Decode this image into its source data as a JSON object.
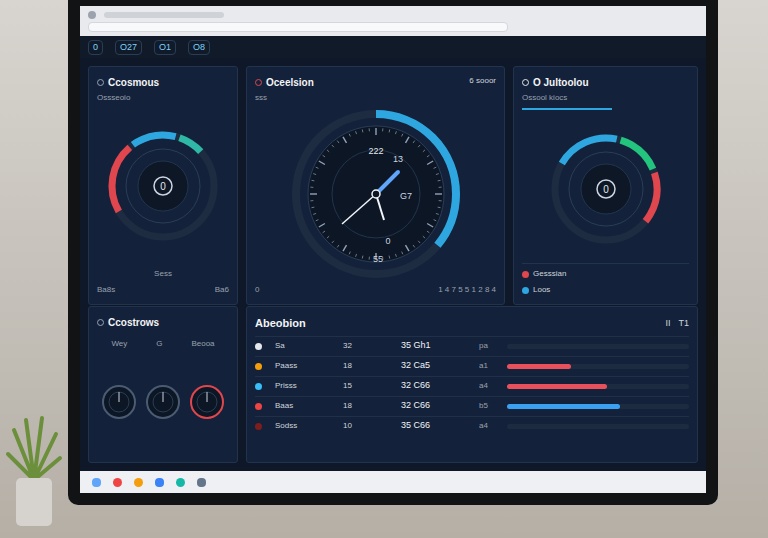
{
  "app_header": {
    "items": [
      "0",
      "O27",
      "O1",
      "O8"
    ]
  },
  "left_gauge": {
    "title": "Ccosmous",
    "subtitle": "Ossseoio",
    "center": "0",
    "label": "Sess",
    "footer_left": "Ba8s",
    "footer_right": "Ba6",
    "segments": [
      {
        "color": "#e0464e",
        "level": 0.22
      },
      {
        "color": "#2ea7e0",
        "level": 0.14
      },
      {
        "color": "#2fb8a5",
        "level": 0.08
      }
    ]
  },
  "clock_panel": {
    "title": "Oceelsion",
    "subtitle": "sss",
    "badge": "6 sooor",
    "readout": "222",
    "markers": [
      "13",
      "G7",
      "0",
      "55"
    ],
    "level": 0.36,
    "footer_left": "0",
    "footer_right": "1 4 7 5 5 1 2 8 4"
  },
  "right_gauge": {
    "title": "O Jultoolou",
    "subtitle": "Ossool kiocs",
    "center": "0",
    "segments": [
      {
        "color": "#2ea7e0",
        "level": 0.2
      },
      {
        "color": "#22c47e",
        "level": 0.14
      },
      {
        "color": "#e0464e",
        "level": 0.16
      }
    ],
    "legend": [
      {
        "label": "Gesssian",
        "color": "#e0464e"
      },
      {
        "label": "Loos",
        "color": "#2ea7e0"
      }
    ]
  },
  "controls": {
    "title": "Ccostrows",
    "labels": [
      "Wey",
      "G",
      "Beooa"
    ],
    "dials": [
      {
        "color": "#4b5b72"
      },
      {
        "color": "#4b5b72"
      },
      {
        "color": "#e0464e"
      }
    ]
  },
  "table": {
    "title": "Abeobion",
    "icons": [
      "II",
      "T1"
    ],
    "rows": [
      {
        "name": "Sa",
        "count": "32",
        "value": "35 Gh1",
        "tick": "pa",
        "color": "#e5e7eb",
        "level": 0
      },
      {
        "name": "Paass",
        "count": "18",
        "value": "32 Ca5",
        "tick": "a1",
        "color": "#f59e0b",
        "level": 0.35,
        "bar_color": "#e8505b"
      },
      {
        "name": "Prisss",
        "count": "15",
        "value": "32 C66",
        "tick": "a4",
        "color": "#38bdf8",
        "level": 0.55,
        "bar_color": "#e8505b"
      },
      {
        "name": "Baas",
        "count": "18",
        "value": "32 C66",
        "tick": "b5",
        "color": "#ef4444",
        "level": 0.62,
        "bar_color": "#3aa0f0"
      },
      {
        "name": "Sodss",
        "count": "10",
        "value": "35 C66",
        "tick": "a4",
        "color": "#7f1d1d",
        "level": 0
      }
    ]
  }
}
